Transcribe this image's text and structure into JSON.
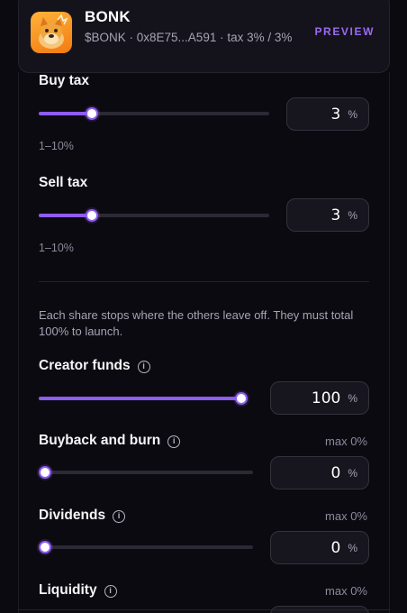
{
  "token": {
    "name": "BONK",
    "meta": "$BONK · 0x8E75...A591 · tax 3% / 3%",
    "preview_label": "PREVIEW",
    "logo_icon": "bonk-dog-logo"
  },
  "buy_tax": {
    "label": "Buy tax",
    "value": "3",
    "unit": "%",
    "range_hint": "1–10%",
    "level": 0.23
  },
  "sell_tax": {
    "label": "Sell tax",
    "value": "3",
    "unit": "%",
    "range_hint": "1–10%",
    "level": 0.23
  },
  "allocation": {
    "explanation": "Each share stops where the others leave off. They must total 100% to launch.",
    "items": [
      {
        "label": "Creator funds",
        "value": "100",
        "unit": "%",
        "max_note": "",
        "level": 1.0
      },
      {
        "label": "Buyback and burn",
        "value": "0",
        "unit": "%",
        "max_note": "max 0%",
        "level": 0.0
      },
      {
        "label": "Dividends",
        "value": "0",
        "unit": "%",
        "max_note": "max 0%",
        "level": 0.0
      },
      {
        "label": "Liquidity",
        "value": "",
        "unit": "",
        "max_note": "max 0%",
        "level": 0.0
      }
    ]
  },
  "colors": {
    "accent": "#8e5cf0",
    "background": "#0b0a10",
    "card": "#14131b"
  }
}
